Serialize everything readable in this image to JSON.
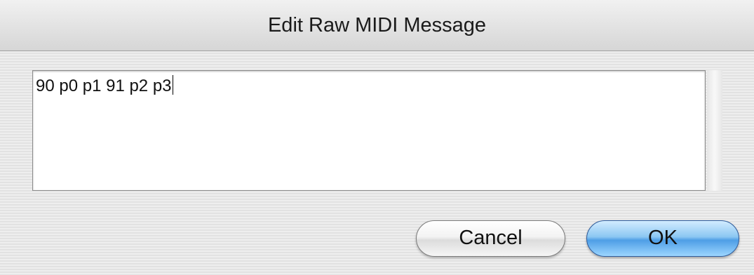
{
  "dialog": {
    "title": "Edit Raw MIDI Message",
    "message_field": {
      "value": "90 p0 p1 91 p2 p3"
    },
    "buttons": {
      "cancel_label": "Cancel",
      "ok_label": "OK"
    }
  },
  "colors": {
    "default_button_accent": "#4e9ee6",
    "dialog_background": "#ececec"
  }
}
